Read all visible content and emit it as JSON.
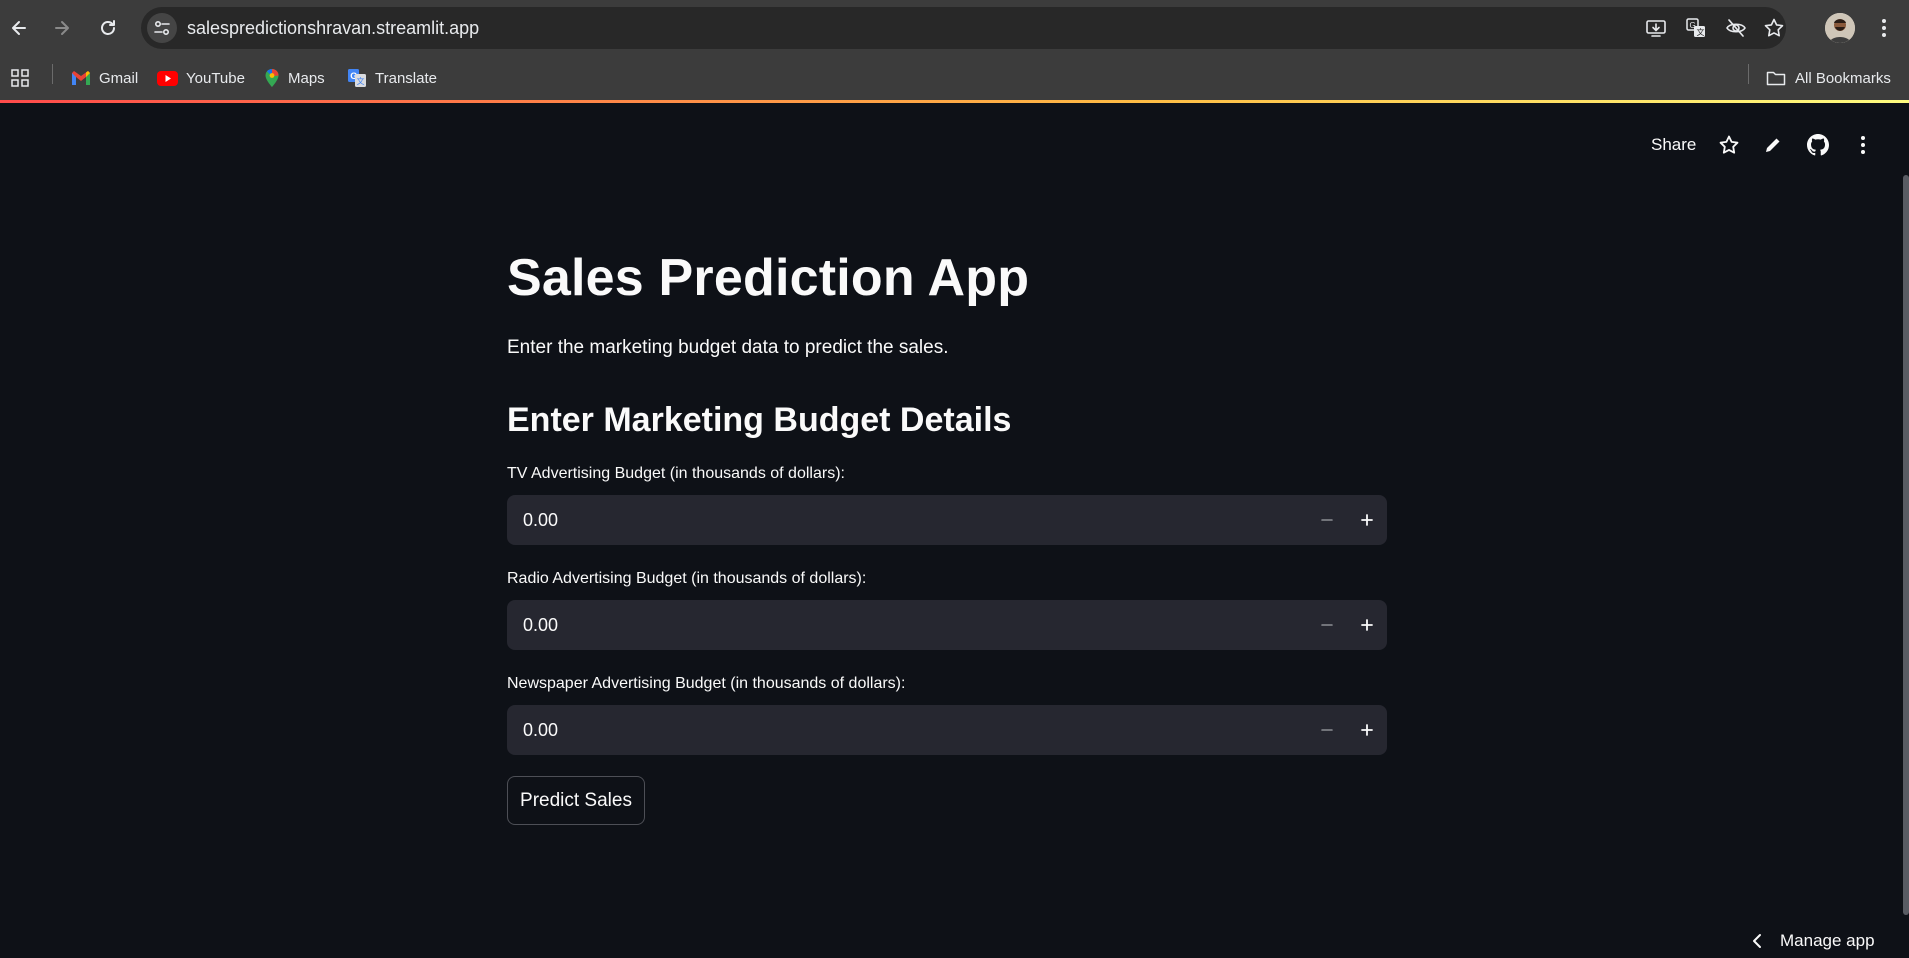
{
  "browser": {
    "url": "salespredictionshravan.streamlit.app",
    "bookmarks": [
      {
        "label": "Gmail",
        "icon": "gmail-icon"
      },
      {
        "label": "YouTube",
        "icon": "youtube-icon"
      },
      {
        "label": "Maps",
        "icon": "maps-icon"
      },
      {
        "label": "Translate",
        "icon": "translate-icon"
      }
    ],
    "all_bookmarks_label": "All Bookmarks"
  },
  "header": {
    "share_label": "Share"
  },
  "main": {
    "title": "Sales Prediction App",
    "subtitle": "Enter the marketing budget data to predict the sales.",
    "section_heading": "Enter Marketing Budget Details",
    "inputs": [
      {
        "label": "TV Advertising Budget (in thousands of dollars):",
        "value": "0.00"
      },
      {
        "label": "Radio Advertising Budget (in thousands of dollars):",
        "value": "0.00"
      },
      {
        "label": "Newspaper Advertising Budget (in thousands of dollars):",
        "value": "0.00"
      }
    ],
    "predict_label": "Predict Sales"
  },
  "footer": {
    "manage_app_label": "Manage app"
  },
  "colors": {
    "background": "#0e1117",
    "input_bg": "#262730",
    "chrome": "#3c3c3c",
    "text": "#fafafa"
  }
}
